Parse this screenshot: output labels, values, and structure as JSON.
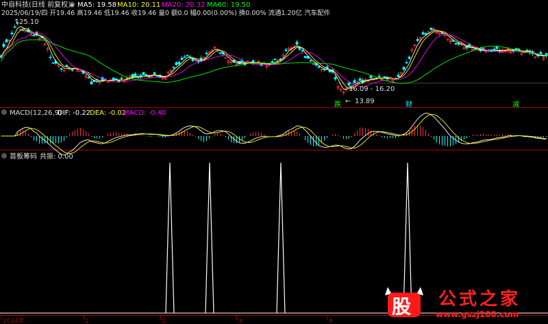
{
  "header": {
    "stock_name": "中自科技(日线 前复权)",
    "ma_items": [
      {
        "label": "MA5: 19.58",
        "color": "#ffffff"
      },
      {
        "label": "MA10: 20.11",
        "color": "#ffff00"
      },
      {
        "label": "MA20: 20.32",
        "color": "#ff00ff"
      },
      {
        "label": "MA60: 19.50",
        "color": "#00ff00"
      }
    ],
    "quote_line": "2025/06/19/四 开19.46 高19.46 低19.46 收19.46 量0 额0.0 幅0.00(0.00%) 换0.00% 流通1.20亿 汽车配件"
  },
  "price_annotations": {
    "high_label": "25.10",
    "low_label": "13.89",
    "range_label": "16.09 - 16.20",
    "marks": [
      {
        "text": "跌",
        "color": "#00ff00"
      },
      {
        "text": "财",
        "color": "#00ffff"
      },
      {
        "text": "减",
        "color": "#00ff00"
      }
    ]
  },
  "macd_header": {
    "name": "MACD(12,26,9)",
    "dif": "DIF: -0.22",
    "dea": "DEA: -0.02",
    "macd": "MACD: -0.40"
  },
  "indicator_header": {
    "name": "首板筹码",
    "value": "共振: 0.00"
  },
  "x_axis": {
    "labels": [
      "2024年",
      "1",
      "2",
      "3",
      "4"
    ]
  },
  "watermark": {
    "badge": "股",
    "title": "公式之家",
    "url": "www.gszj100.com"
  },
  "chart_data": [
    {
      "type": "line",
      "title": "中自科技(日线 前复权)",
      "x": [
        0,
        4,
        8,
        12,
        16,
        20,
        24,
        28,
        32,
        36,
        40,
        44,
        48,
        52,
        56,
        60,
        64,
        68,
        72,
        76,
        80,
        84,
        88,
        92,
        96,
        100,
        104,
        108,
        112,
        116,
        120,
        124,
        128,
        132,
        136,
        140,
        144,
        148,
        152,
        156,
        160,
        164,
        168,
        172,
        176,
        180,
        184,
        188,
        192,
        196,
        200,
        204,
        208,
        212,
        216,
        220,
        224,
        228,
        232,
        236,
        240,
        244,
        248,
        252,
        256,
        260,
        264,
        268,
        272,
        276,
        280,
        284,
        288,
        292,
        296,
        300,
        304,
        308,
        312,
        316,
        320,
        324,
        328,
        332,
        336,
        340,
        344,
        348,
        352,
        356,
        360,
        364,
        368,
        372,
        376,
        380,
        384,
        388,
        392,
        396,
        400,
        404,
        408,
        412,
        416,
        420,
        424,
        428,
        432,
        436,
        440,
        444,
        448,
        452,
        456,
        460,
        464,
        468,
        472,
        476,
        480,
        484,
        488,
        492,
        496,
        500,
        504,
        508,
        512,
        516,
        520,
        524,
        528,
        532,
        536,
        540,
        544,
        548,
        552,
        556,
        560,
        564,
        568,
        572,
        576,
        580,
        584,
        588,
        592,
        596,
        600,
        604,
        608,
        612,
        616,
        620,
        624,
        628,
        632,
        636,
        640,
        644,
        648,
        652,
        656,
        660,
        664,
        668,
        672,
        676,
        680,
        684,
        688,
        692,
        696,
        700,
        704,
        708,
        712,
        716,
        720,
        724,
        728,
        732,
        736,
        740,
        744,
        748,
        752,
        756,
        760,
        764,
        768,
        772,
        776,
        780,
        784,
        788,
        792,
        796
      ],
      "series": [
        {
          "name": "MA5",
          "color": "#ffffff"
        },
        {
          "name": "MA10",
          "color": "#ffff00"
        },
        {
          "name": "MA20",
          "color": "#ff00ff"
        },
        {
          "name": "MA60",
          "color": "#00ff00"
        }
      ],
      "annotations": [
        "25.10",
        "13.89",
        "16.09 - 16.20"
      ]
    },
    {
      "type": "bar",
      "title": "MACD(12,26,9)",
      "series": [
        {
          "name": "DIF",
          "value": -0.22,
          "color": "#ffffff"
        },
        {
          "name": "DEA",
          "value": -0.02,
          "color": "#ffff00"
        },
        {
          "name": "MACD",
          "value": -0.4,
          "color": "#ff00ff"
        }
      ]
    },
    {
      "type": "line",
      "title": "首板筹码",
      "series": [
        {
          "name": "共振",
          "value": 0.0,
          "color": "#ffffff"
        }
      ],
      "spikes_at_month": [
        "2",
        "3",
        "3",
        "4"
      ]
    }
  ]
}
